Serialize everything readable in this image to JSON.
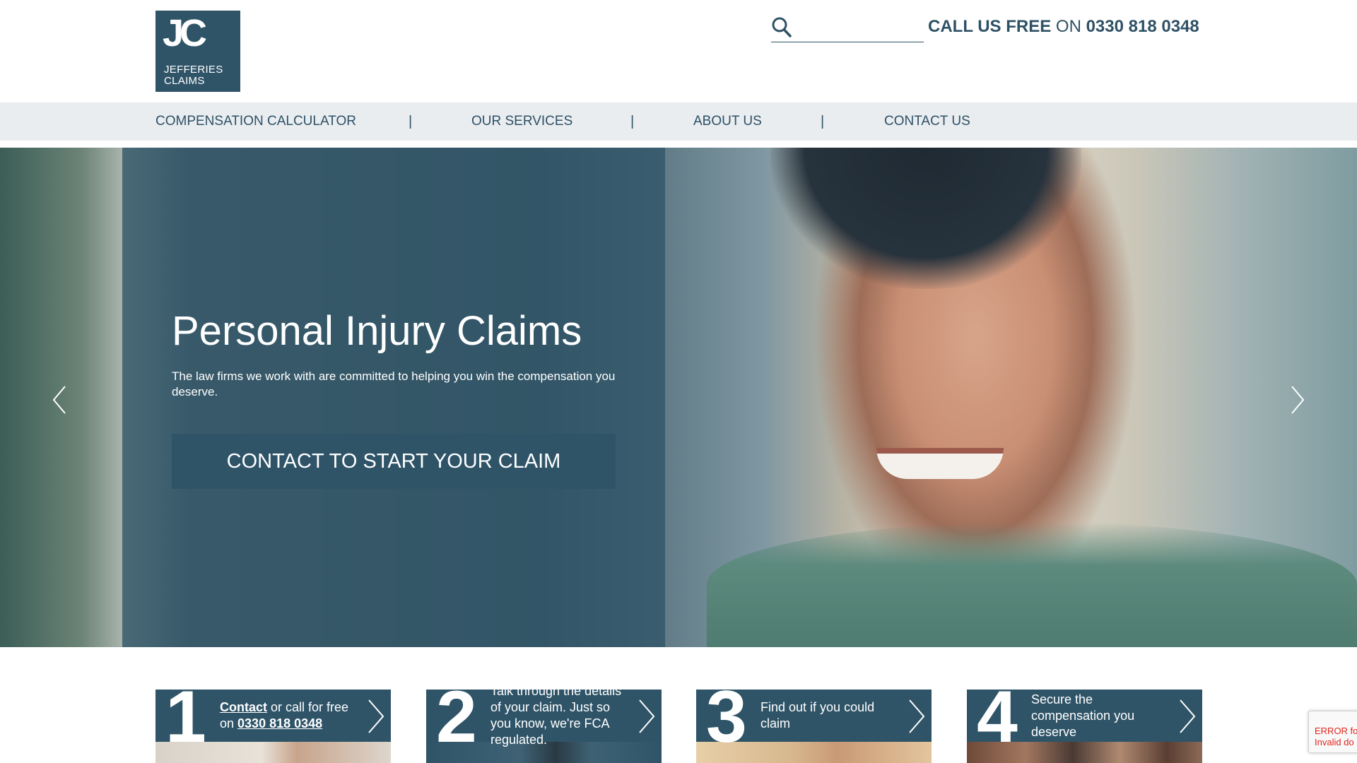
{
  "brand": {
    "logo_mark": "JC",
    "logo_line1": "JEFFERIES",
    "logo_line2": "CLAIMS"
  },
  "header": {
    "search_placeholder": "",
    "phone_prefix_bold": "CALL US FREE",
    "phone_on": "ON",
    "phone_number": "0330 818 0348"
  },
  "nav": {
    "items": [
      {
        "label": "COMPENSATION CALCULATOR"
      },
      {
        "label": "OUR SERVICES"
      },
      {
        "label": "ABOUT US"
      },
      {
        "label": "CONTACT US"
      }
    ],
    "separator": "|"
  },
  "hero": {
    "title": "Personal Injury Claims",
    "text": "The law firms we work with are committed to helping you win the compensation you deserve.",
    "cta": "CONTACT TO START YOUR CLAIM"
  },
  "steps": [
    {
      "num": "1",
      "link": "Contact",
      "text_mid": " or call for free on ",
      "phone": "0330 818 0348"
    },
    {
      "num": "2",
      "text": "Talk through the details of your claim. Just so you know, we're FCA regulated."
    },
    {
      "num": "3",
      "text": "Find out if you could claim"
    },
    {
      "num": "4",
      "text": "Secure the compensation you deserve"
    }
  ],
  "recaptcha": {
    "line1": "ERROR fo",
    "line2": "Invalid do"
  },
  "colors": {
    "brand_blue": "#2f5468",
    "nav_bg": "#e9edf0",
    "text": "#2e5166",
    "error": "#e1251b"
  }
}
